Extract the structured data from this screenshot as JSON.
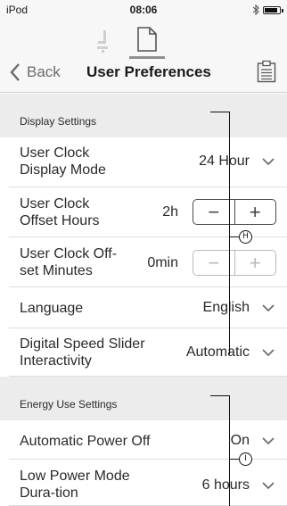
{
  "status_bar": {
    "carrier": "iPod",
    "time": "08:06",
    "bluetooth_icon": "bluetooth-icon",
    "battery_level": 0.85
  },
  "nav": {
    "tabs": [
      {
        "icon": "wheelchair-icon",
        "selected": false
      },
      {
        "icon": "document-icon",
        "selected": true
      }
    ],
    "back_label": "Back",
    "title": "User Preferences",
    "right_icon": "clipboard-icon"
  },
  "sections": [
    {
      "header": "Display Settings",
      "rows": [
        {
          "label": "User Clock Display Mode",
          "value": "24 Hour",
          "control": "dropdown"
        },
        {
          "label": "User Clock Offset Hours",
          "value": "2h",
          "control": "stepper",
          "minus": "−",
          "plus": "+"
        },
        {
          "label": "User Clock Off-set Minutes",
          "value": "0min",
          "control": "stepper",
          "minus": "−",
          "plus": "+"
        },
        {
          "label": "Language",
          "value": "English",
          "control": "dropdown"
        },
        {
          "label": "Digital Speed Slider Interactivity",
          "value": "Automatic",
          "control": "dropdown"
        }
      ]
    },
    {
      "header": "Energy Use Settings",
      "rows": [
        {
          "label": "Automatic Power Off",
          "value": "On",
          "control": "dropdown"
        },
        {
          "label": "Low Power Mode Dura-tion",
          "value": "6 hours",
          "control": "dropdown"
        }
      ]
    }
  ],
  "callouts": [
    {
      "letter": "H"
    },
    {
      "letter": "I"
    }
  ],
  "colors": {
    "nav_bg": "#f7f7f7",
    "section_bg": "#ececec",
    "text": "#2a2a2a",
    "muted": "#6b6b6b"
  }
}
